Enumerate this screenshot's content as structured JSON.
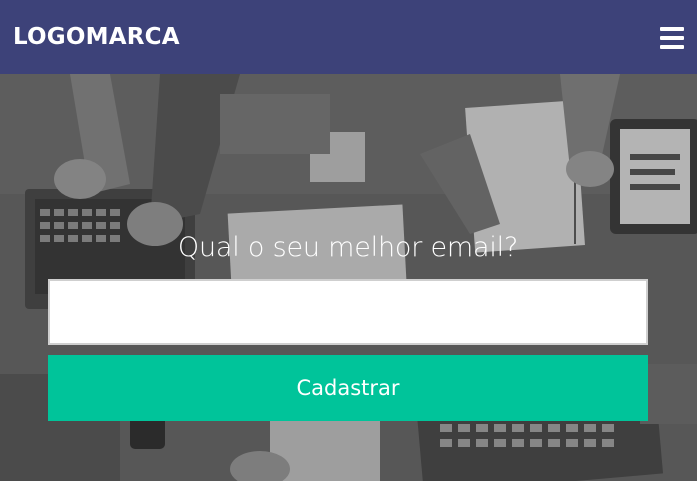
{
  "header": {
    "logo": "LOGOMARCA",
    "menu_icon": "hamburger-menu-icon",
    "background_color": "#3d4279"
  },
  "hero": {
    "background_description_icon": "desk-workspace-photo",
    "form": {
      "title": "Qual o seu melhor email?",
      "email_value": "",
      "email_placeholder": "",
      "submit_label": "Cadastrar",
      "submit_color": "#00c49a"
    }
  }
}
